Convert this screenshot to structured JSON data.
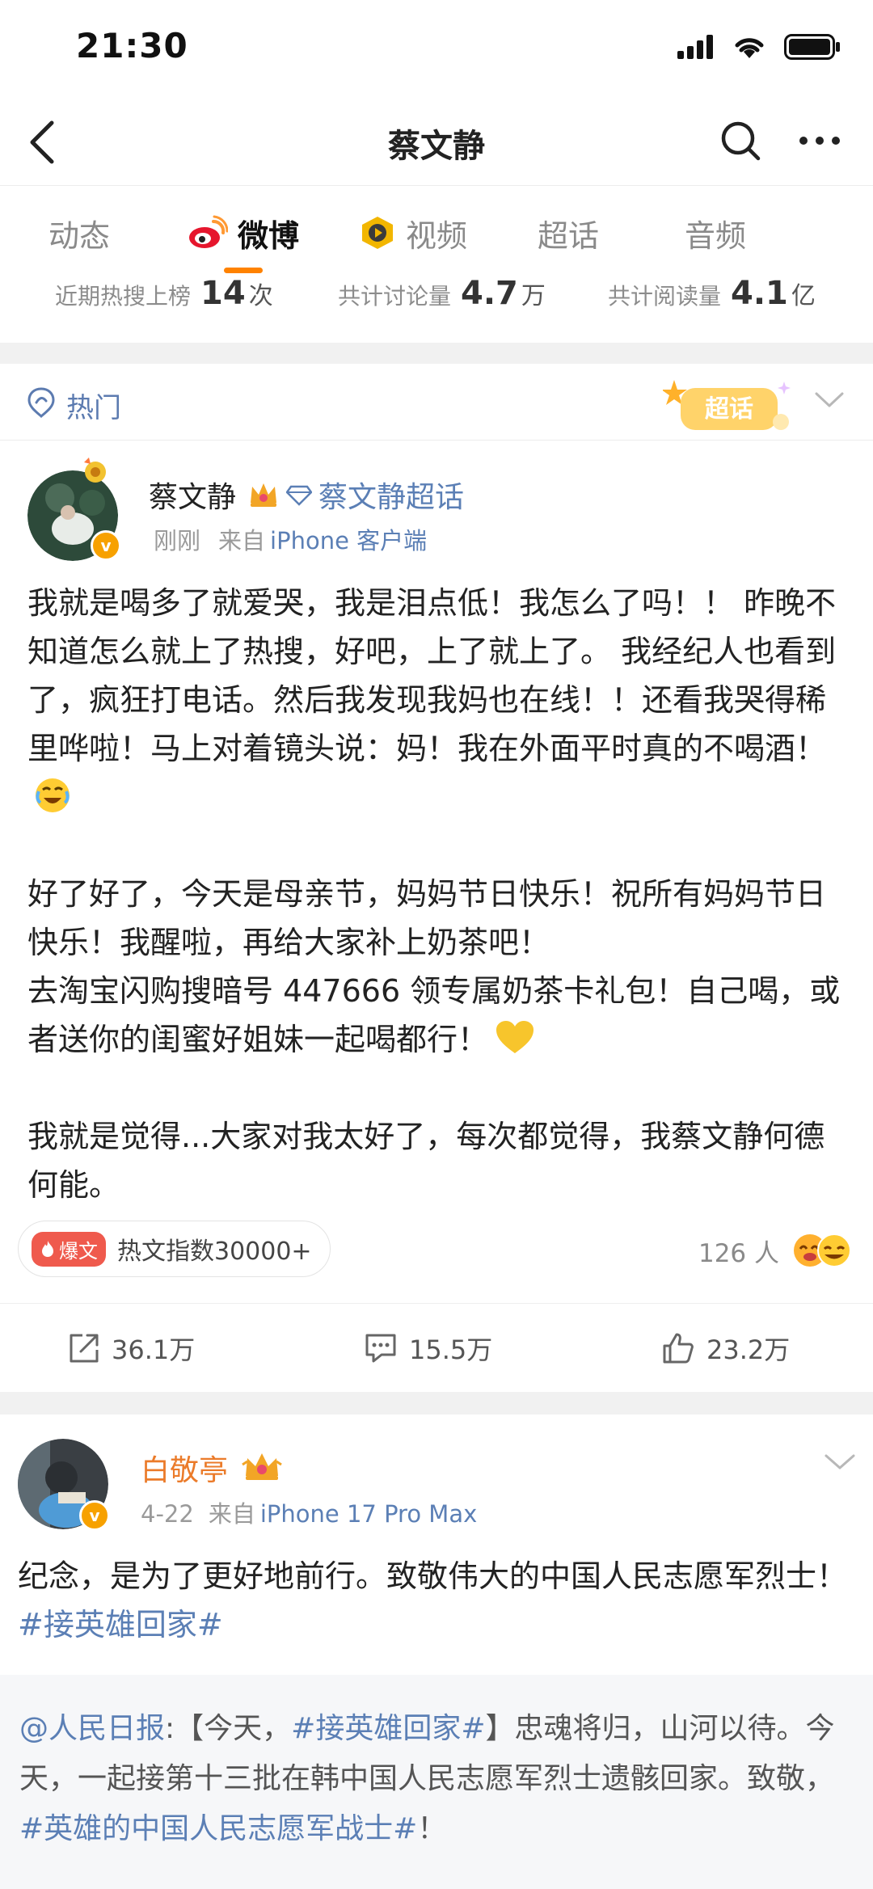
{
  "status_bar": {
    "time": "21:30"
  },
  "nav": {
    "title": "蔡文静"
  },
  "tabs": [
    {
      "label": "动态",
      "active": false
    },
    {
      "label": "微博",
      "active": true,
      "icon": "weibo-logo-icon"
    },
    {
      "label": "视频",
      "active": false,
      "icon": "video-badge-icon"
    },
    {
      "label": "超话",
      "active": false
    },
    {
      "label": "音频",
      "active": false
    }
  ],
  "stats": [
    {
      "label": "近期热搜上榜",
      "value": "14",
      "unit": "次"
    },
    {
      "label": "共计讨论量",
      "value": "4.7",
      "unit": "万"
    },
    {
      "label": "共计阅读量",
      "value": "4.1",
      "unit": "亿"
    }
  ],
  "hot_section": {
    "label": "热门",
    "badge_text": "超话"
  },
  "post1": {
    "author": "蔡文静",
    "topic": "蔡文静超话",
    "time": "刚刚",
    "source_prefix": "来自",
    "source": "iPhone 客户端",
    "paragraphs": [
      "我就是喝多了就爱哭，我是泪点低！我怎么了吗！！ 昨晚不知道怎么就上了热搜，好吧，上了就上了。 我经纪人也看到了，疯狂打电话。然后我发现我妈也在线！！还看我哭得稀里哗啦！马上对着镜头说：妈！我在外面平时真的不喝酒！",
      "好了好了，今天是母亲节，妈妈节日快乐！祝所有妈妈节日快乐！我醒啦，再给大家补上奶茶吧！",
      "去淘宝闪购搜暗号 447666 领专属奶茶卡礼包！自己喝，或者送你的闺蜜好姐妹一起喝都行！",
      "我就是觉得...大家对我太好了，每次都觉得，我蔡文静何德何能。"
    ],
    "hot_tag": "爆文",
    "hot_index": "热文指数30000+",
    "likers_count": "126 人",
    "repost_count": "36.1万",
    "comment_count": "15.5万",
    "like_count": "23.2万"
  },
  "post2": {
    "author": "白敬亭",
    "time": "4-22",
    "source_prefix": "来自",
    "source": "iPhone 17 Pro Max",
    "text_main": "纪念，是为了更好地前行。致敬伟大的中国人民志愿军烈士！",
    "hashtag": "#接英雄回家#",
    "repost": {
      "mention": "@人民日报",
      "colon": ":",
      "open": "【今天，",
      "hashtag1": "#接英雄回家#",
      "mid": "】忠魂将归，山河以待。今天，一起接第十三批在韩中国人民志愿军烈士遗骸回家。致敬，",
      "hashtag2": "#英雄的中国人民志愿军战士#",
      "end": "！"
    }
  }
}
